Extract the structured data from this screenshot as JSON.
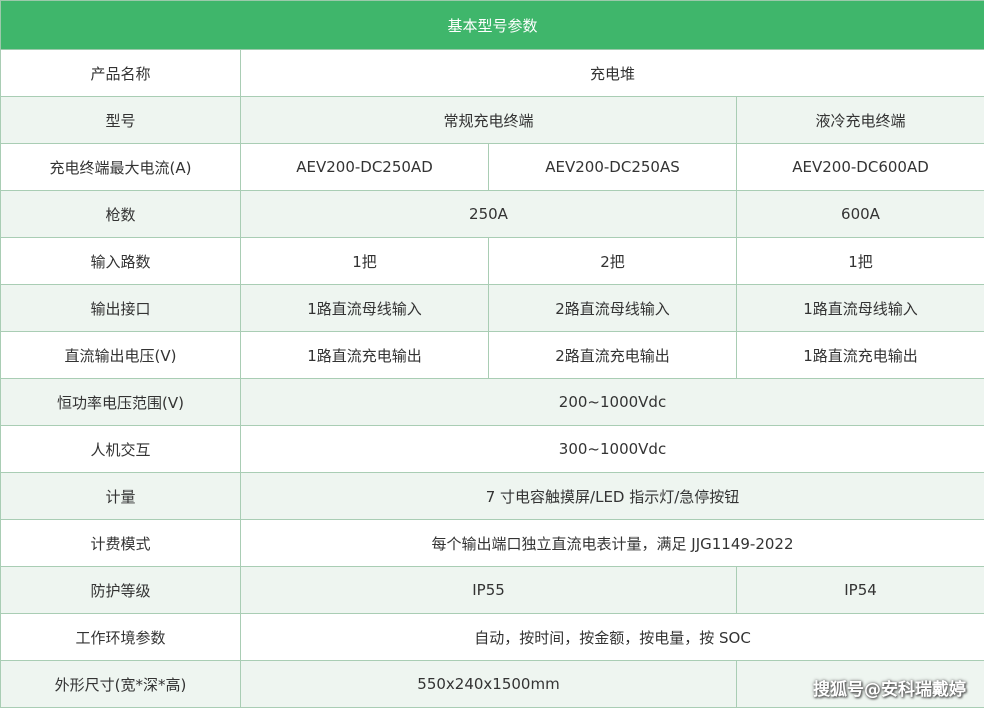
{
  "title": "基本型号参数",
  "rows": {
    "product_name": {
      "label": "产品名称",
      "value": "充电堆"
    },
    "model": {
      "label": "型号",
      "conventional": "常规充电终端",
      "liquid": "液冷充电终端"
    },
    "max_current": {
      "label": "充电终端最大电流(A)",
      "c1": "AEV200-DC250AD",
      "c2": "AEV200-DC250AS",
      "c3": "AEV200-DC600AD"
    },
    "guns": {
      "label": "枪数",
      "c12": "250A",
      "c3": "600A"
    },
    "input_routes": {
      "label": "输入路数",
      "c1": "1把",
      "c2": "2把",
      "c3": "1把"
    },
    "output_interface": {
      "label": "输出接口",
      "c1": "1路直流母线输入",
      "c2": "2路直流母线输入",
      "c3": "1路直流母线输入"
    },
    "dc_output_voltage": {
      "label": "直流输出电压(V)",
      "c1": "1路直流充电输出",
      "c2": "2路直流充电输出",
      "c3": "1路直流充电输出"
    },
    "const_power_range": {
      "label": "恒功率电压范围(V)",
      "value": "200~1000Vdc"
    },
    "hmi": {
      "label": "人机交互",
      "value": "300~1000Vdc"
    },
    "metering": {
      "label": "计量",
      "value": "7 寸电容触摸屏/LED 指示灯/急停按钮"
    },
    "billing_mode": {
      "label": "计费模式",
      "value": "每个输出端口独立直流电表计量，满足 JJG1149-2022"
    },
    "protection": {
      "label": "防护等级",
      "c12": "IP55",
      "c3": "IP54"
    },
    "env_params": {
      "label": "工作环境参数",
      "value": "自动，按时间，按金额，按电量，按 SOC"
    },
    "dimensions": {
      "label": "外形尺寸(宽*深*高)",
      "c12": "550x240x1500mm",
      "c3": ""
    }
  },
  "watermark": "搜狐号@安科瑞戴婷"
}
